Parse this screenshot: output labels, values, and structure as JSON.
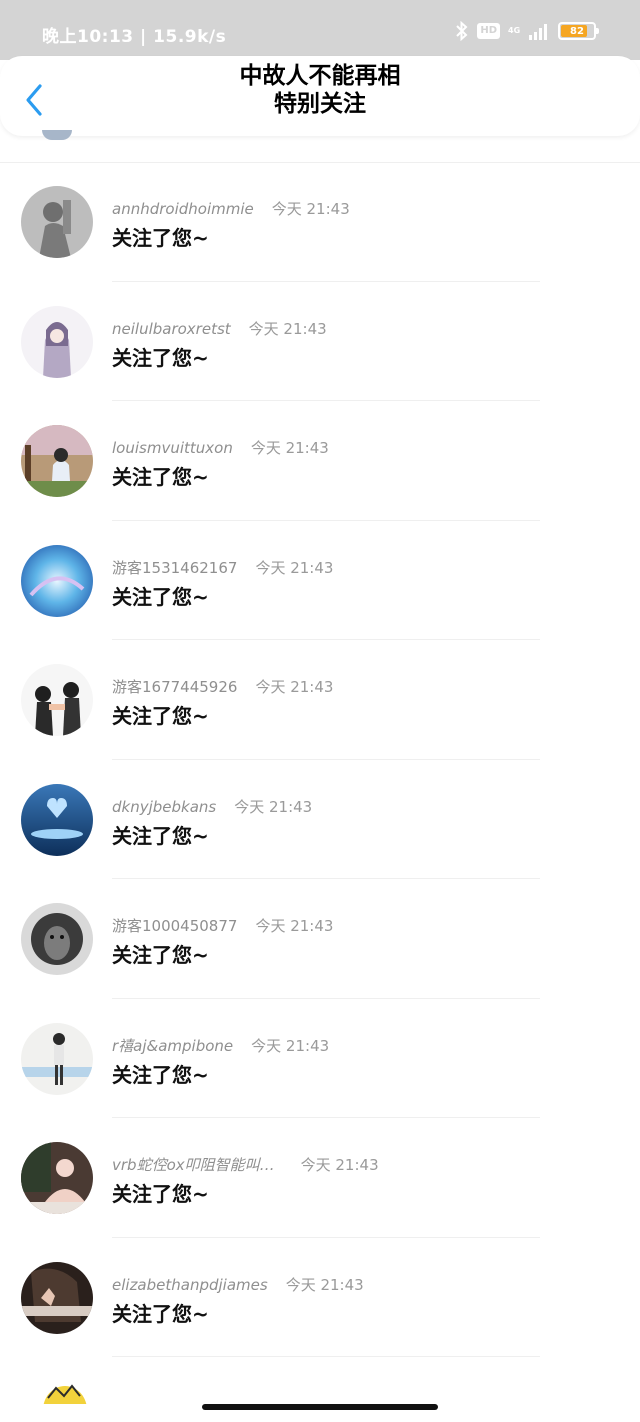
{
  "status": {
    "time": "晚上10:13 | 15.9k/s",
    "hd": "HD",
    "network": "4G",
    "battery": "82",
    "battery_level": 0.82
  },
  "header": {
    "title": "中故人不能再相",
    "subtitle": "特别关注"
  },
  "list": [
    {
      "name": "annhdroidhoimmie",
      "time": "今天 21:43",
      "message": "关注了您~"
    },
    {
      "name": "neilulbaroxretst",
      "time": "今天 21:43",
      "message": "关注了您~"
    },
    {
      "name": "louismvuittuxon",
      "time": "今天 21:43",
      "message": "关注了您~"
    },
    {
      "name": "游客1531462167",
      "time": "今天 21:43",
      "message": "关注了您~"
    },
    {
      "name": "游客1677445926",
      "time": "今天 21:43",
      "message": "关注了您~"
    },
    {
      "name": "dknyjbebkans",
      "time": "今天 21:43",
      "message": "关注了您~"
    },
    {
      "name": "游客1000450877",
      "time": "今天 21:43",
      "message": "关注了您~"
    },
    {
      "name": "r禧aj&ampibone",
      "time": "今天 21:43",
      "message": "关注了您~"
    },
    {
      "name": "vrb蛇倥ox叩阻智能叫…",
      "time": "今天 21:43",
      "message": "关注了您~"
    },
    {
      "name": "elizabethanpdjiames",
      "time": "今天 21:43",
      "message": "关注了您~"
    }
  ],
  "colors": {
    "accent": "#2b9cf0",
    "statusbar": "#d4d4d4",
    "battery": "#f5a623"
  },
  "icons": {
    "back": "chevron-left-icon",
    "bluetooth": "bluetooth-icon",
    "signal": "signal-icon"
  }
}
